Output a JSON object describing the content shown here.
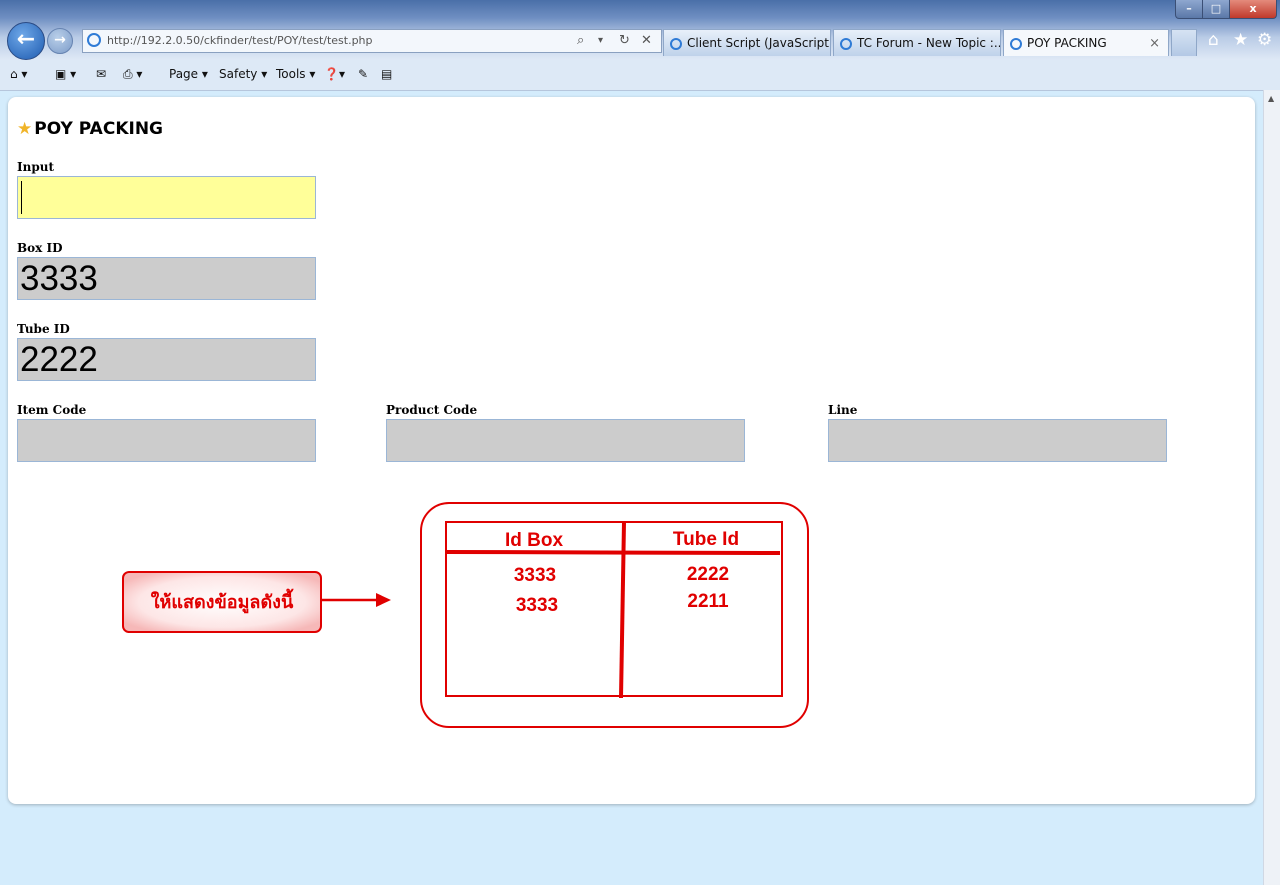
{
  "window": {
    "min": "–",
    "max": "□",
    "close": "x"
  },
  "browser": {
    "url": "http://192.2.0.50/ckfinder/test/POY/test/test.php",
    "address_tools": [
      "⌕",
      "▾",
      "↻",
      "✕"
    ],
    "tabs": [
      {
        "label": "Client Script (JavaScript, ..."
      },
      {
        "label": "TC Forum - New Topic :..."
      },
      {
        "label": "POY PACKING",
        "close": "×"
      }
    ],
    "right_tools": [
      "⌂",
      "★",
      "⚙"
    ],
    "command_bar": {
      "home": "⌂ ▾",
      "feeds": "▣ ▾",
      "mail": "✉",
      "print": "⎙ ▾",
      "page": "Page ▾",
      "safety": "Safety ▾",
      "tools": "Tools ▾",
      "help": "❓▾",
      "research": "✎",
      "translate": "▤"
    }
  },
  "page": {
    "title": "POY PACKING",
    "star_icon": "★",
    "fields": {
      "input": {
        "label": "Input",
        "value": ""
      },
      "box_id": {
        "label": "Box ID",
        "value": "3333"
      },
      "tube_id": {
        "label": "Tube ID",
        "value": "2222"
      },
      "item_code": {
        "label": "Item Code",
        "value": ""
      },
      "product_code": {
        "label": "Product Code",
        "value": ""
      },
      "line": {
        "label": "Line",
        "value": ""
      }
    }
  },
  "annotation": {
    "callout": "ให้แสดงข้อมูลดังนี้",
    "table_headers": [
      "Id Box",
      "Tube Id"
    ],
    "table_rows": [
      [
        "3333",
        "2222"
      ],
      [
        "3333",
        "2211"
      ]
    ],
    "color": "#e00000"
  }
}
